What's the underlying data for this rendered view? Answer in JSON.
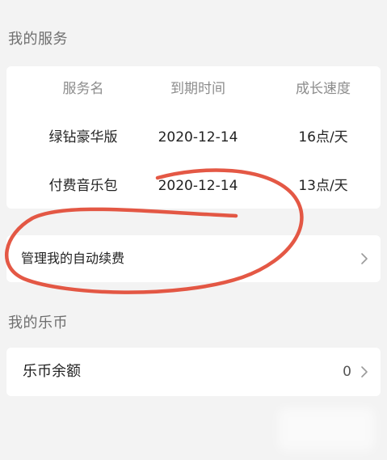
{
  "services": {
    "title": "我的服务",
    "headers": [
      "服务名",
      "到期时间",
      "成长速度"
    ],
    "rows": [
      {
        "name": "绿钻豪华版",
        "expiry": "2020-12-14",
        "speed": "16点/天"
      },
      {
        "name": "付费音乐包",
        "expiry": "2020-12-14",
        "speed": "13点/天"
      }
    ],
    "manage_label": "管理我的自动续费"
  },
  "coins": {
    "title": "我的乐币",
    "balance_label": "乐币余额",
    "balance_value": "0"
  },
  "icons": {
    "manage_chevron": "chevron-right-icon",
    "coin_chevron": "chevron-right-icon"
  },
  "colors": {
    "annotation_circle": "#e24a35",
    "background": "#f3f3f3",
    "card": "#ffffff"
  }
}
